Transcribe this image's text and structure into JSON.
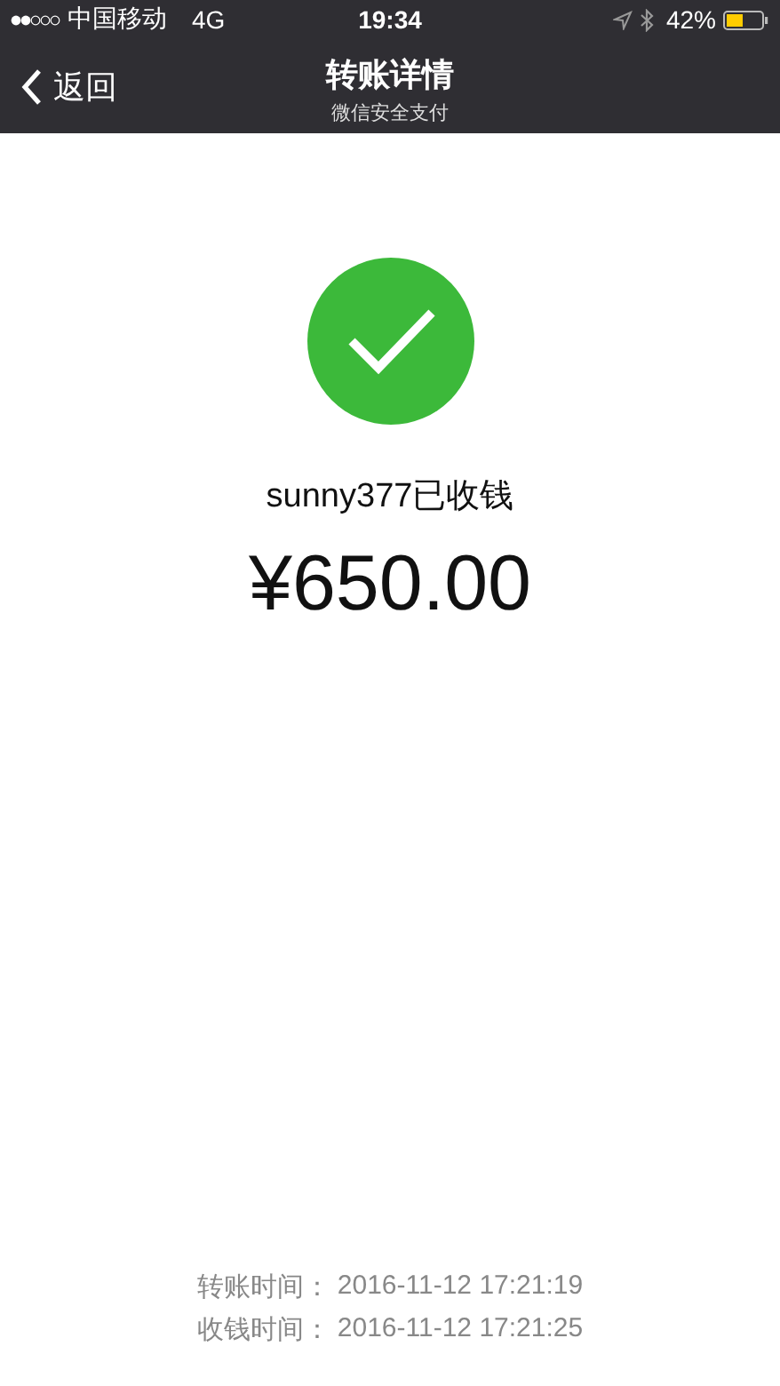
{
  "status_bar": {
    "carrier": "中国移动",
    "network": "4G",
    "time": "19:34",
    "battery": "42%"
  },
  "nav_bar": {
    "back": "返回",
    "title": "转账详情",
    "subtitle": "微信安全支付"
  },
  "result": {
    "message": "sunny377已收钱",
    "amount": "¥650.00"
  },
  "details": [
    {
      "label": "转账时间：",
      "value": "2016-11-12 17:21:19"
    },
    {
      "label": "收钱时间：",
      "value": "2016-11-12 17:21:25"
    }
  ]
}
